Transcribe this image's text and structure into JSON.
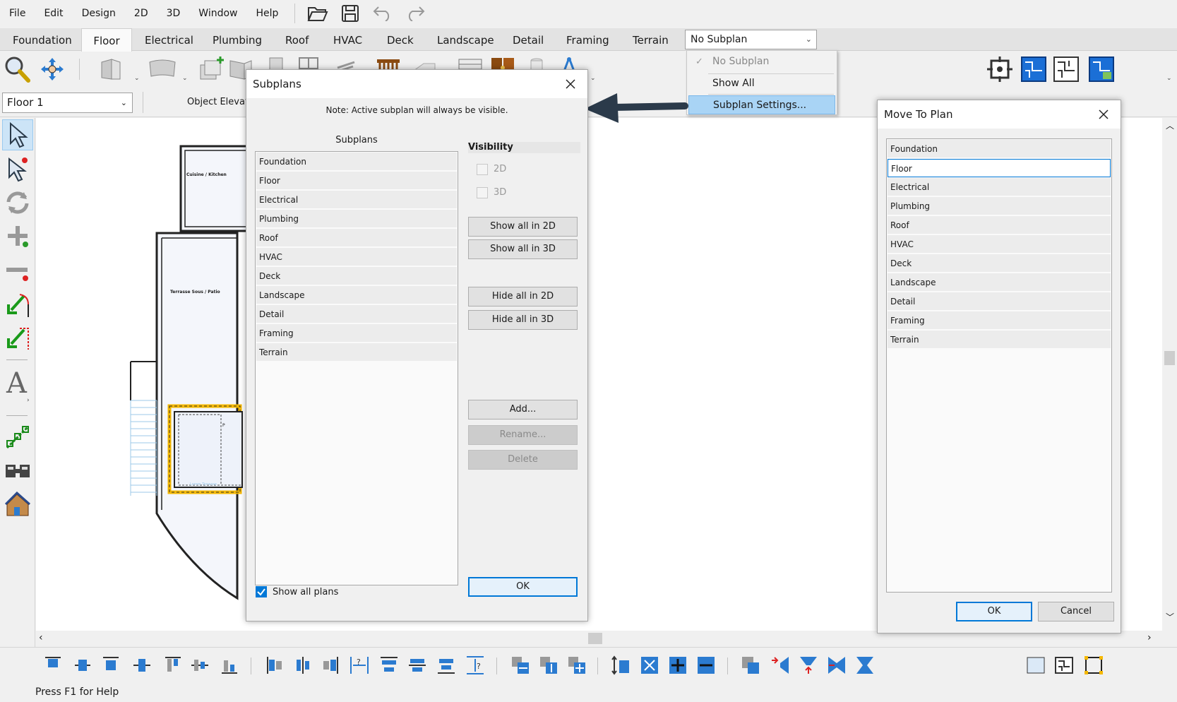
{
  "menu": [
    "File",
    "Edit",
    "Design",
    "2D",
    "3D",
    "Window",
    "Help"
  ],
  "tabs": [
    "Foundation",
    "Floor",
    "Electrical",
    "Plumbing",
    "Roof",
    "HVAC",
    "Deck",
    "Landscape",
    "Detail",
    "Framing",
    "Terrain"
  ],
  "active_tab": "Floor",
  "subplan_combo": "No Subplan",
  "subplan_menu": {
    "items": [
      {
        "label": "No Subplan",
        "state": "checked-disabled"
      },
      {
        "label": "Show All",
        "state": "normal"
      },
      {
        "label": "Subplan Settings...",
        "state": "highlighted"
      }
    ]
  },
  "floor_select": "Floor 1",
  "object_elevation_label": "Object Elevat",
  "plan_labels": {
    "kitchen": "Cuisine / Kitchen",
    "patio": "Terrasse Sous / Patio"
  },
  "subplans_dialog": {
    "title": "Subplans",
    "note": "Note: Active subplan will always be visible.",
    "list_header": "Subplans",
    "items": [
      "Foundation",
      "Floor",
      "Electrical",
      "Plumbing",
      "Roof",
      "HVAC",
      "Deck",
      "Landscape",
      "Detail",
      "Framing",
      "Terrain"
    ],
    "visibility_header": "Visibility",
    "vis_2d": "2D",
    "vis_3d": "3D",
    "btn_show_2d": "Show all in 2D",
    "btn_show_3d": "Show all in 3D",
    "btn_hide_2d": "Hide all in 2D",
    "btn_hide_3d": "Hide all in 3D",
    "btn_add": "Add...",
    "btn_rename": "Rename...",
    "btn_delete": "Delete",
    "show_all_plans": "Show all plans",
    "btn_ok": "OK"
  },
  "move_dialog": {
    "title": "Move To Plan",
    "items": [
      "Foundation",
      "Floor",
      "Electrical",
      "Plumbing",
      "Roof",
      "HVAC",
      "Deck",
      "Landscape",
      "Detail",
      "Framing",
      "Terrain"
    ],
    "selected": "Floor",
    "btn_ok": "OK",
    "btn_cancel": "Cancel"
  },
  "status": "Press F1 for Help",
  "colors": {
    "accent": "#0078d7",
    "highlight": "#a9d4f5",
    "arrow": "#2b3a4a",
    "selection_outline": "#f5b800"
  }
}
